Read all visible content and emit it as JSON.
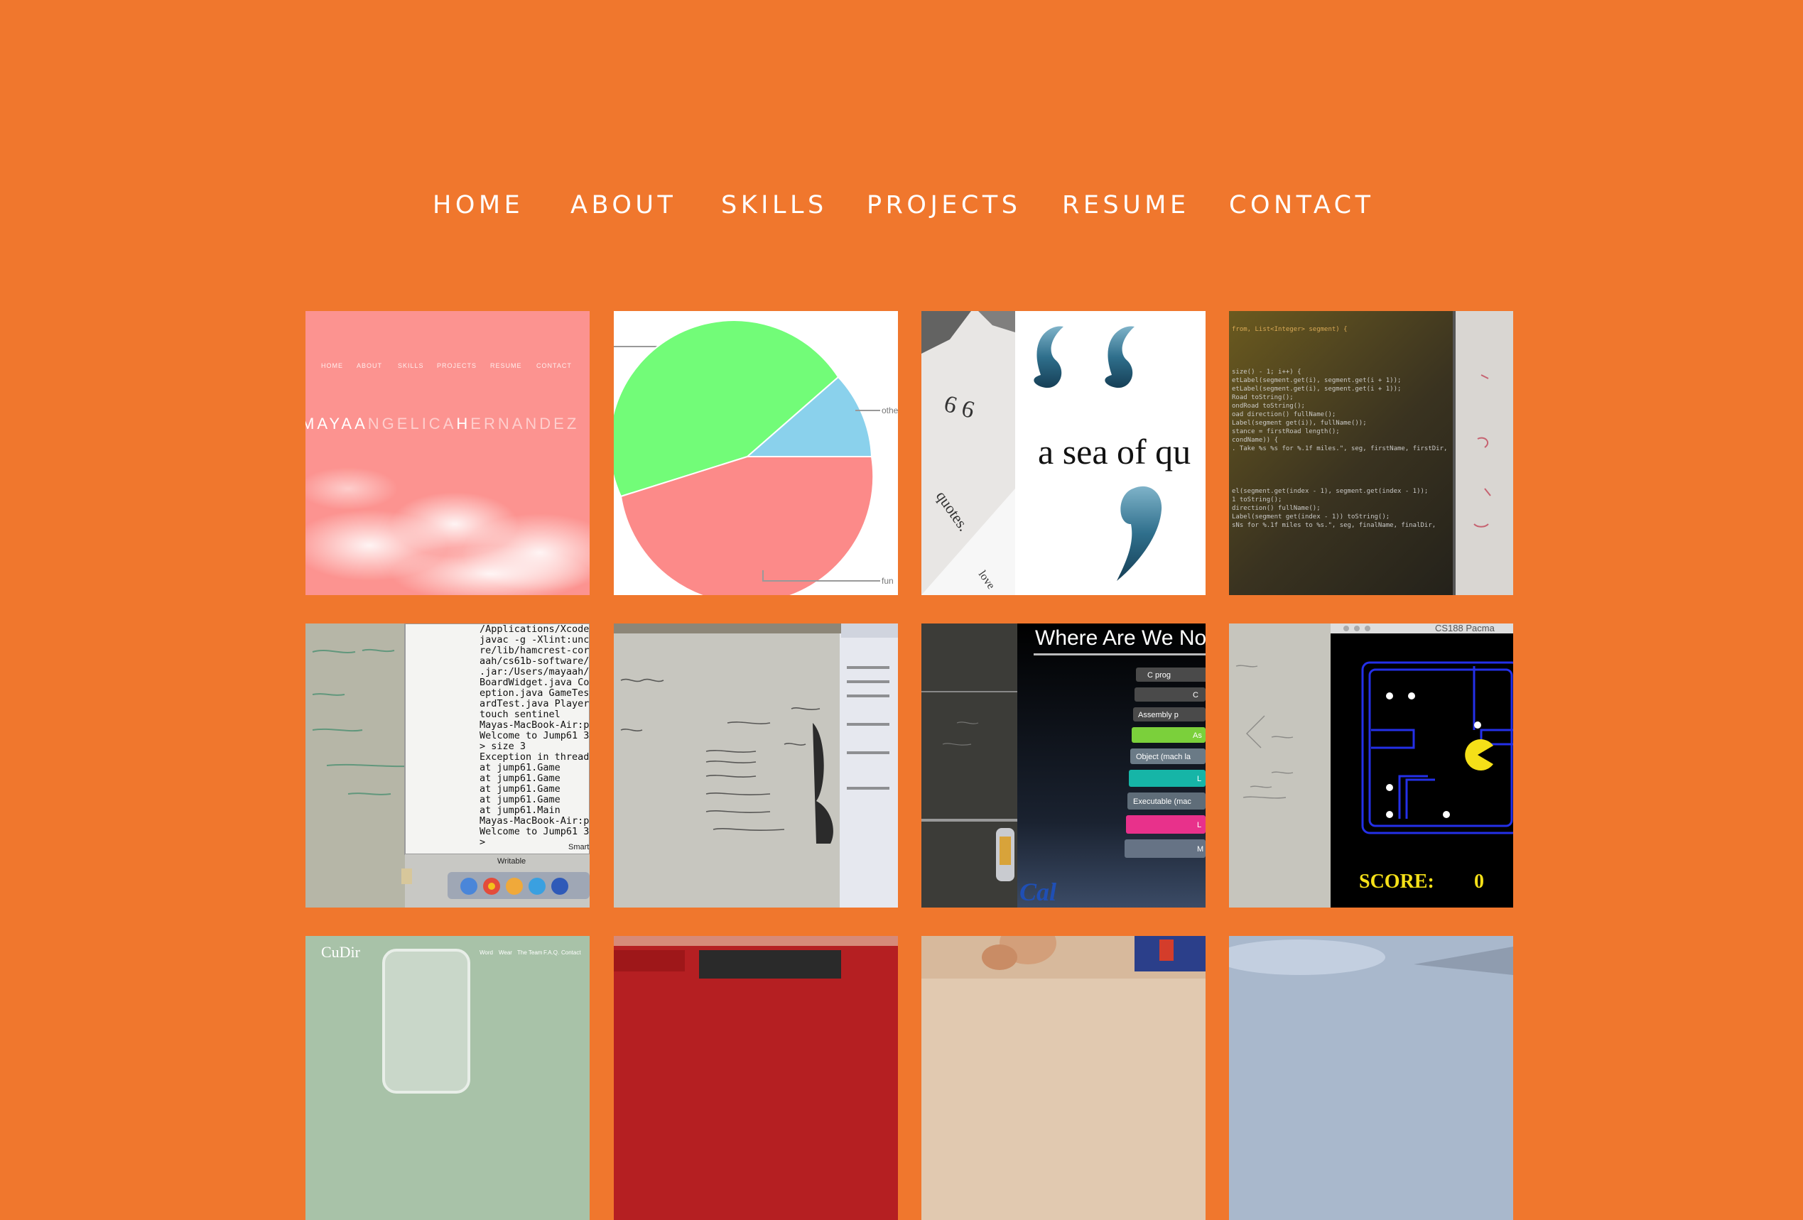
{
  "nav": {
    "items": [
      {
        "label": "HOME"
      },
      {
        "label": "ABOUT"
      },
      {
        "label": "SKILLS"
      },
      {
        "label": "PROJECTS"
      },
      {
        "label": "RESUME"
      },
      {
        "label": "CONTACT"
      }
    ]
  },
  "tiles": {
    "personal_site": {
      "nav": [
        "HOME",
        "ABOUT",
        "SKILLS",
        "PROJECTS",
        "RESUME",
        "CONTACT"
      ],
      "name_parts": [
        "MAYA",
        "A",
        "NGELICA",
        "H",
        "ERNANDEZ"
      ]
    },
    "pie": {
      "label_other": "other",
      "label_fun": "fun"
    },
    "quotes": {
      "caption": "a sea of qu",
      "side_a": "quotes.",
      "side_b": "love"
    },
    "code": {
      "lines": [
        "from, List<Integer> segment) {",
        "size() - 1; i++) {",
        "etLabel(segment.get(i), segment.get(i + 1));",
        "etLabel(segment.get(i), segment.get(i + 1));",
        "Road toString();",
        "ondRoad toString();",
        "oad direction() fullName();",
        "Label(segment get(i)), fullName());",
        "stance = firstRoad length();",
        "condName)) {",
        ". Take %s %s for %.1f miles.\", seg, firstName, firstDir,",
        "el(segment.get(index - 1), segment.get(index - 1));",
        "1 toString();",
        "direction() fullName();",
        "Label(segment get(index - 1)) toString();",
        "sNs for %.1f miles to %s.\", seg, finalName, finalDir,"
      ]
    },
    "terminal": {
      "lines": [
        "/Applications/Xcode.app",
        "javac -g -Xlint:unchecked",
        "re/lib/hamcrest-core-1",
        "aah/cs61b-software/lib",
        ".jar:/Users/mayaah/cs6",
        "BoardWidget.java Const",
        "eption.java GameTest.j",
        "ardTest.java Player.ja",
        "touch sentinel",
        "Mayas-MacBook-Air:proj",
        "Welcome to Jump61 3.0",
        "> size 3",
        "Exception in thread \"m",
        "    at jump61.Game",
        "    at jump61.Game",
        "    at jump61.Game",
        "    at jump61.Game",
        "    at jump61.Main",
        "Mayas-MacBook-Air:proj",
        "Welcome to Jump61 3.0",
        ">"
      ],
      "status_left": "Writable",
      "status_right": "Smart"
    },
    "stack": {
      "title": "Where Are We No",
      "bars": [
        "C prog",
        "C",
        "Assembly p",
        "As",
        "Object (mach la",
        "L",
        "Executable (mac",
        "L",
        "M"
      ]
    },
    "pacman": {
      "window_title": "CS188 Pacma",
      "score_label": "SCORE:",
      "score_value": "0"
    },
    "cudir": {
      "brand": "CuDir",
      "menu": [
        "Word",
        "Wear",
        "The Team",
        "F.A.Q.",
        "Contact"
      ]
    }
  },
  "colors": {
    "background": "#F0772D",
    "nav_text": "#FFFFFF",
    "pink": "#FC9390",
    "pie_green": "#72FC78",
    "pie_blue": "#8AD1EC",
    "pie_red": "#FC8A89"
  }
}
